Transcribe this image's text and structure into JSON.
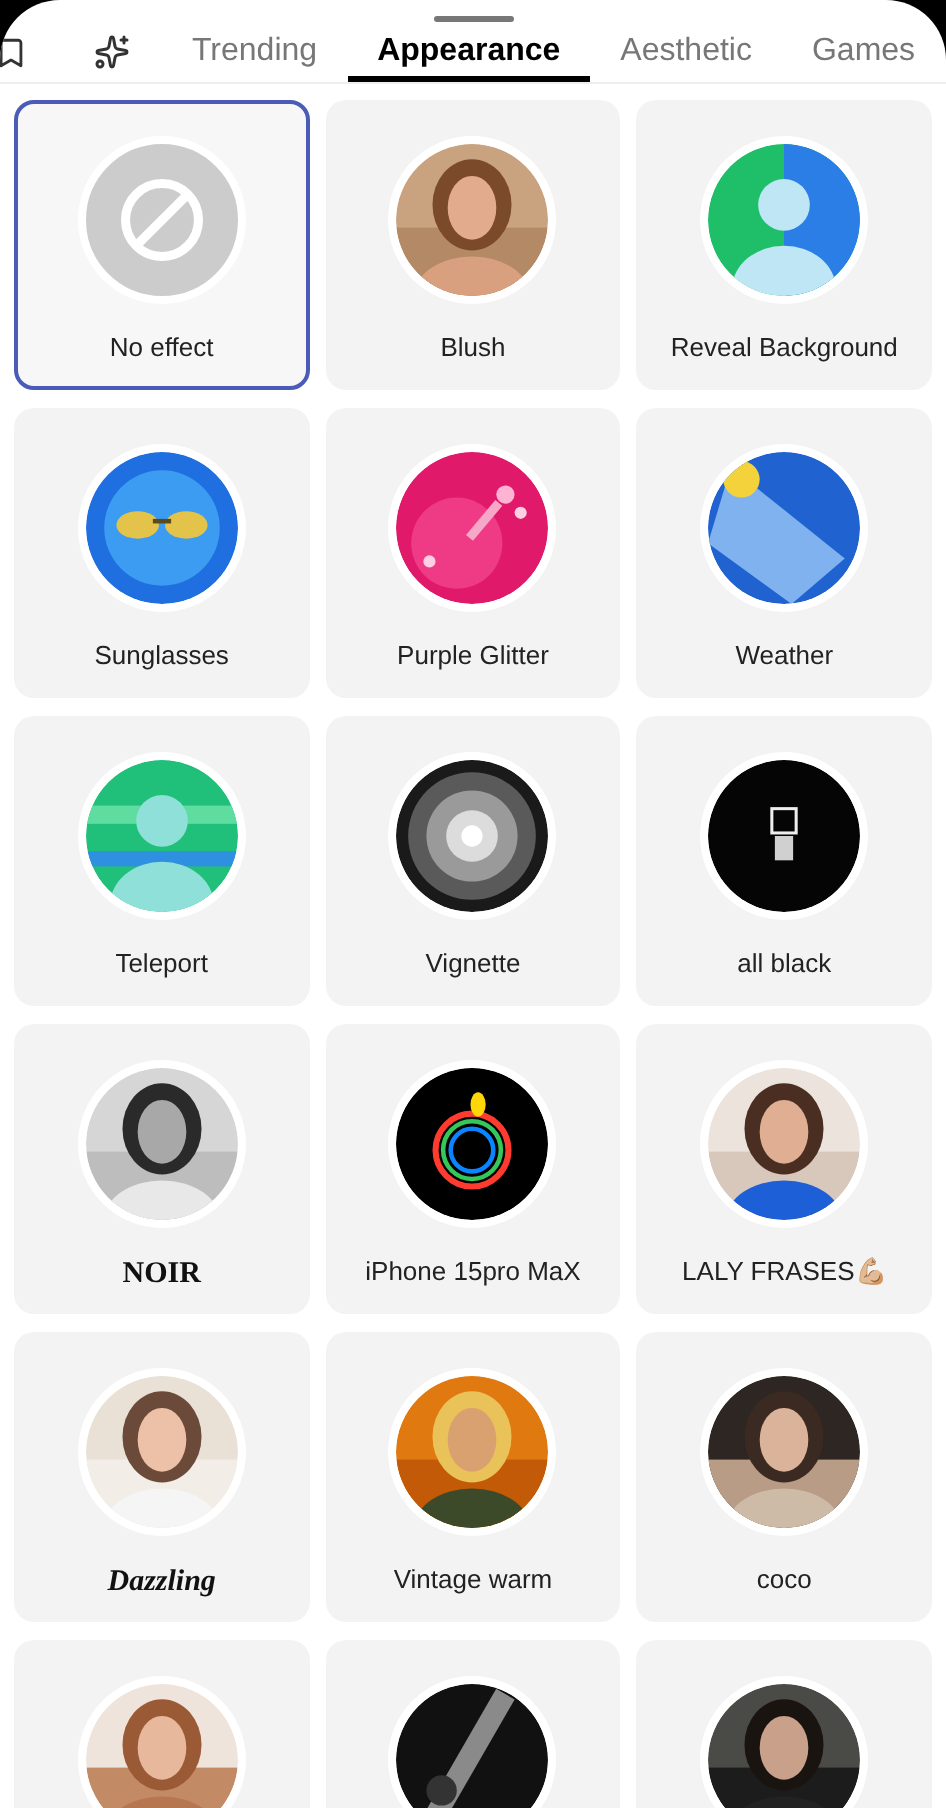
{
  "tabs": [
    {
      "label": "Trending",
      "selected": false
    },
    {
      "label": "Appearance",
      "selected": true
    },
    {
      "label": "Aesthetic",
      "selected": false
    },
    {
      "label": "Games",
      "selected": false
    }
  ],
  "effects": [
    {
      "kind": "none",
      "label": "No effect",
      "selected": true
    },
    {
      "kind": "plain",
      "label": "Blush",
      "selected": false
    },
    {
      "kind": "plain",
      "label": "Reveal Background",
      "selected": false
    },
    {
      "kind": "plain",
      "label": "Sunglasses",
      "selected": false
    },
    {
      "kind": "plain",
      "label": "Purple Glitter",
      "selected": false
    },
    {
      "kind": "plain",
      "label": "Weather",
      "selected": false
    },
    {
      "kind": "plain",
      "label": "Teleport",
      "selected": false
    },
    {
      "kind": "plain",
      "label": "Vignette",
      "selected": false
    },
    {
      "kind": "plain",
      "label": "all black",
      "selected": false
    },
    {
      "kind": "serif",
      "label": "NOIR",
      "selected": false
    },
    {
      "kind": "plain",
      "label": "iPhone 15pro MaX",
      "selected": false
    },
    {
      "kind": "plain",
      "label": "LALY FRASES💪🏼",
      "selected": false
    },
    {
      "kind": "script",
      "label": "Dazzling",
      "selected": false
    },
    {
      "kind": "plain",
      "label": "Vintage warm",
      "selected": false
    },
    {
      "kind": "plain",
      "label": "coco",
      "selected": false
    },
    {
      "kind": "plain",
      "selected": false
    },
    {
      "kind": "plain",
      "selected": false
    },
    {
      "kind": "plain",
      "selected": false
    }
  ]
}
